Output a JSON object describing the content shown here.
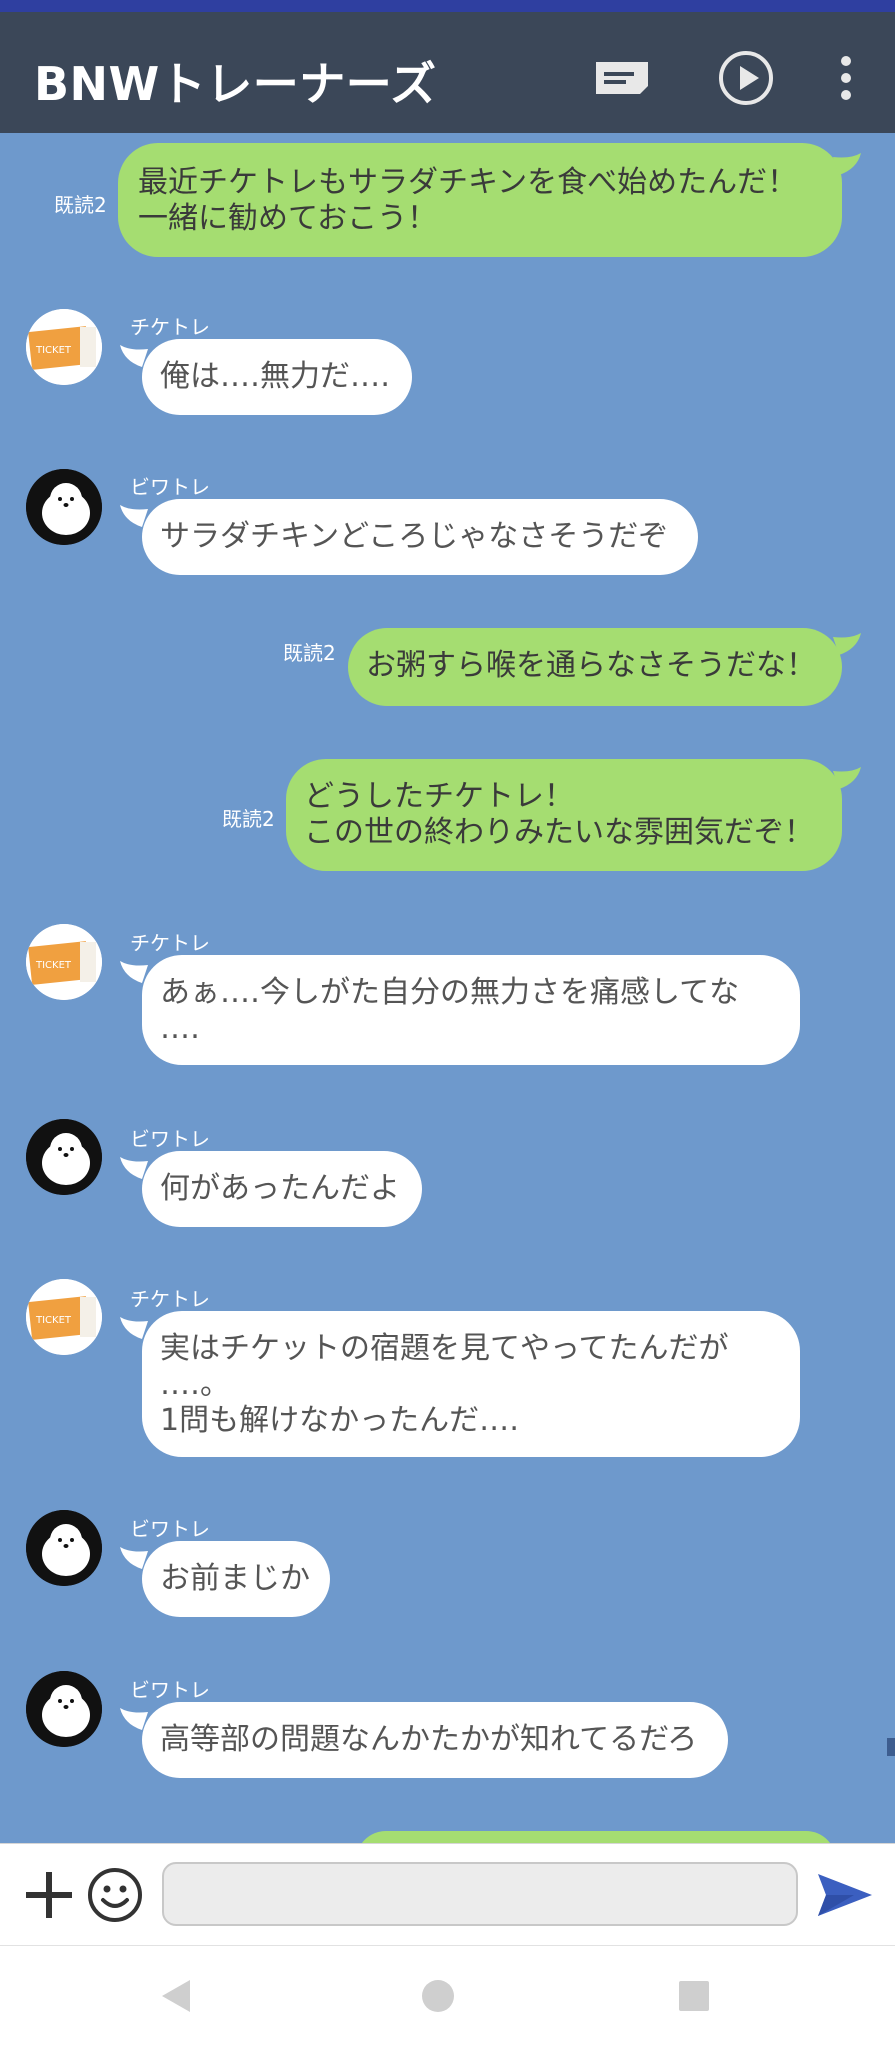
{
  "header": {
    "title": "BNWトレーナーズ"
  },
  "messages": [
    {
      "from": "me",
      "read": "既読2",
      "text": "最近チケトレもサラダチキンを食べ始めたんだ！\n一緒に勧めておこう！"
    },
    {
      "from": "other",
      "sender": "チケトレ",
      "avatar": "ticket-avatar",
      "text": "俺は‥‥無力だ‥‥"
    },
    {
      "from": "other",
      "sender": "ビワトレ",
      "avatar": "dog-avatar",
      "text": "サラダチキンどころじゃなさそうだぞ"
    },
    {
      "from": "me",
      "read": "既読2",
      "text": "お粥すら喉を通らなさそうだな！"
    },
    {
      "from": "me",
      "read": "既読2",
      "text": "どうしたチケトレ！\nこの世の終わりみたいな雰囲気だぞ！"
    },
    {
      "from": "other",
      "sender": "チケトレ",
      "avatar": "ticket-avatar",
      "text": "あぁ‥‥今しがた自分の無力さを痛感してな\n‥‥"
    },
    {
      "from": "other",
      "sender": "ビワトレ",
      "avatar": "dog-avatar",
      "text": "何があったんだよ"
    },
    {
      "from": "other",
      "sender": "チケトレ",
      "avatar": "ticket-avatar",
      "text": "実はチケットの宿題を見てやってたんだが\n‥‥。\n1問も解けなかったんだ‥‥"
    },
    {
      "from": "other",
      "sender": "ビワトレ",
      "avatar": "dog-avatar",
      "text": "お前まじか"
    },
    {
      "from": "other",
      "sender": "ビワトレ",
      "avatar": "dog-avatar",
      "text": "高等部の問題なんかたかが知れてるだろ"
    }
  ],
  "input": {
    "placeholder": ""
  },
  "icons": {
    "plus": "plus-icon",
    "emoji": "emoji-icon",
    "send": "send-icon",
    "notes": "notes-icon",
    "play": "play-icon",
    "more": "more-icon",
    "back": "back-icon",
    "home": "home-icon",
    "recents": "recents-icon"
  },
  "colors": {
    "header_bg": "#3b4758",
    "chat_bg": "#6e99cc",
    "my_bubble": "#a5dd71",
    "other_bubble": "#ffffff",
    "send_accent": "#3b5fc0"
  }
}
